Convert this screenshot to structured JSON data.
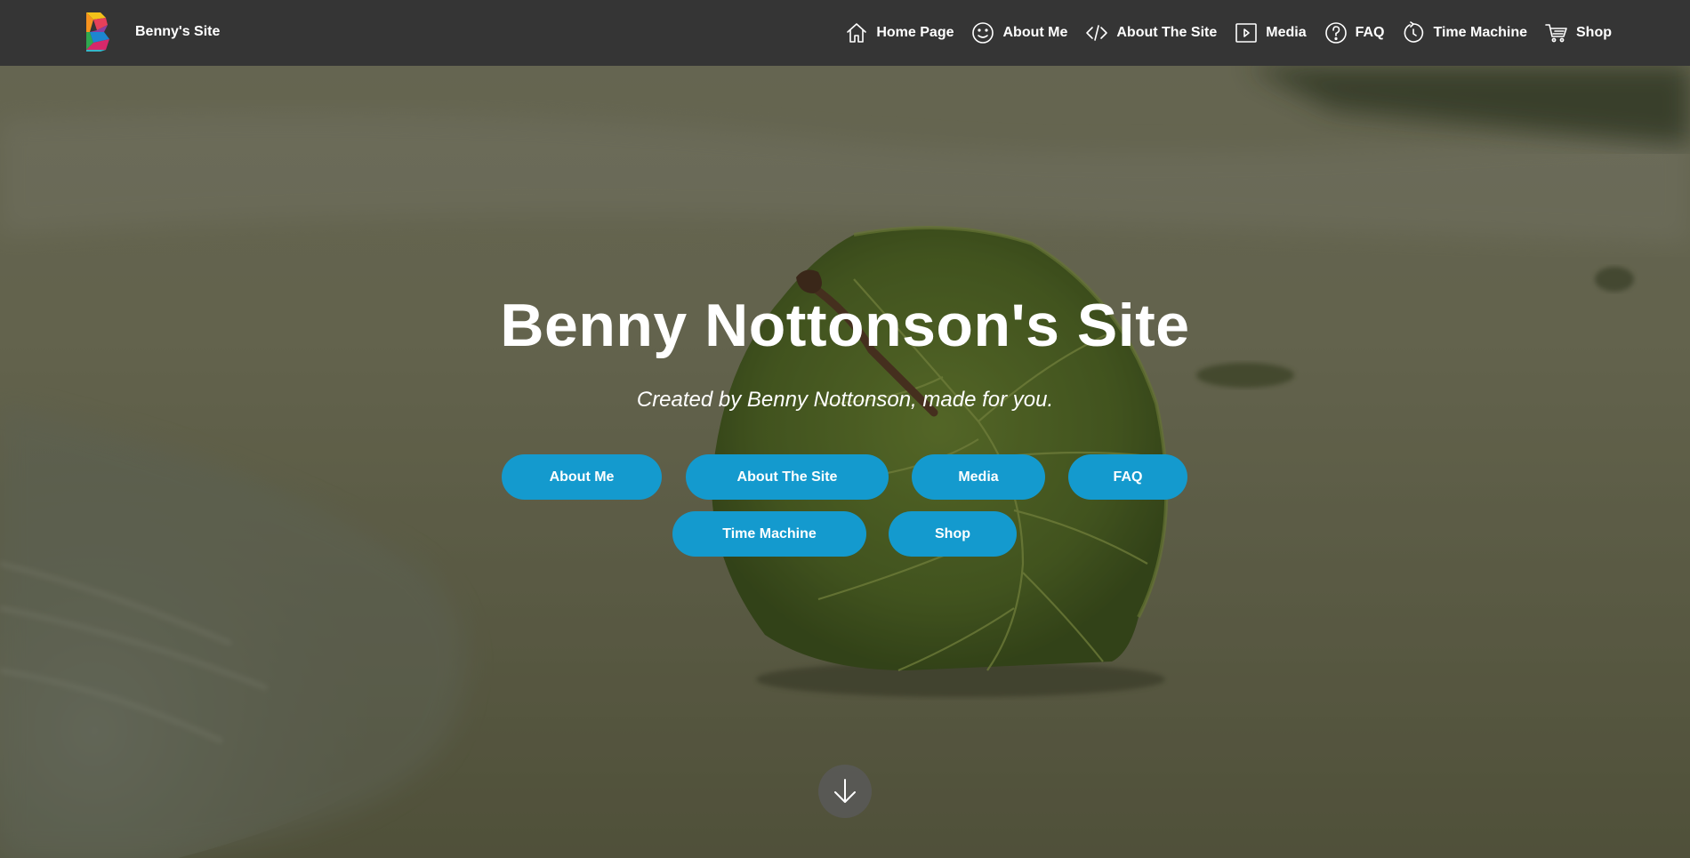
{
  "nav": {
    "brand_name": "Benny's Site",
    "items": [
      {
        "label": "Home Page",
        "icon": "home-icon"
      },
      {
        "label": "About Me",
        "icon": "smiley-icon"
      },
      {
        "label": "About The Site",
        "icon": "code-icon"
      },
      {
        "label": "Media",
        "icon": "play-icon"
      },
      {
        "label": "FAQ",
        "icon": "question-icon"
      },
      {
        "label": "Time Machine",
        "icon": "timer-icon"
      },
      {
        "label": "Shop",
        "icon": "cart-icon"
      }
    ]
  },
  "hero": {
    "title": "Benny Nottonson's Site",
    "subtitle": "Created by Benny Nottonson, made for you.",
    "buttons": [
      "About Me",
      "About The Site",
      "Media",
      "FAQ",
      "Time Machine",
      "Shop"
    ],
    "scroll_icon": "arrow-down-icon"
  },
  "colors": {
    "navbar": "#353535",
    "button": "#149ace",
    "text": "#ffffff"
  }
}
